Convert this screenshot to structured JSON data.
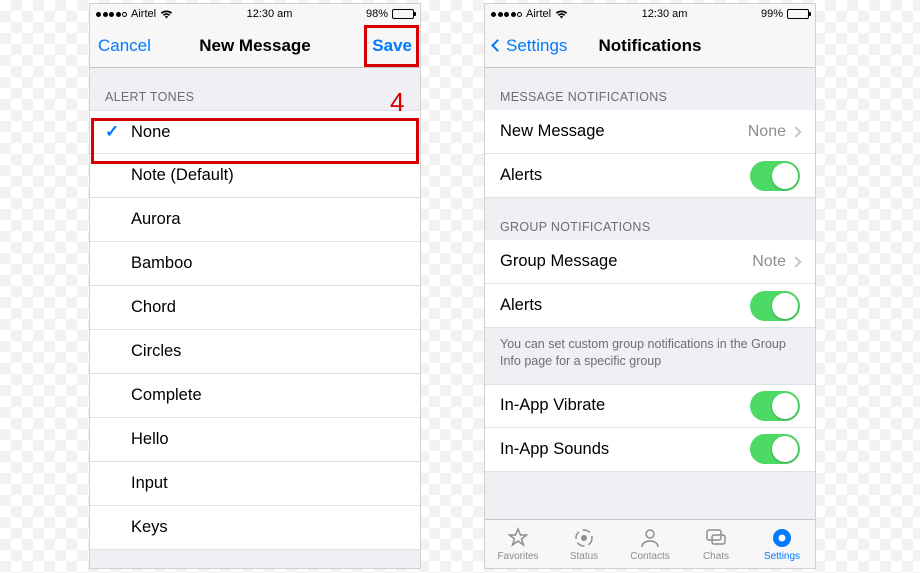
{
  "left": {
    "status": {
      "carrier": "Airtel",
      "time": "12:30 am",
      "battery_pct": "98%"
    },
    "nav": {
      "cancel": "Cancel",
      "title": "New Message",
      "save": "Save"
    },
    "section_header": "ALERT TONES",
    "annotation_number": "4",
    "tones": [
      {
        "label": "None",
        "selected": true
      },
      {
        "label": "Note (Default)",
        "selected": false
      },
      {
        "label": "Aurora",
        "selected": false
      },
      {
        "label": "Bamboo",
        "selected": false
      },
      {
        "label": "Chord",
        "selected": false
      },
      {
        "label": "Circles",
        "selected": false
      },
      {
        "label": "Complete",
        "selected": false
      },
      {
        "label": "Hello",
        "selected": false
      },
      {
        "label": "Input",
        "selected": false
      },
      {
        "label": "Keys",
        "selected": false
      }
    ]
  },
  "right": {
    "status": {
      "carrier": "Airtel",
      "time": "12:30 am",
      "battery_pct": "99%"
    },
    "nav": {
      "back": "Settings",
      "title": "Notifications"
    },
    "sections": {
      "msg_header": "MESSAGE NOTIFICATIONS",
      "new_message_label": "New Message",
      "new_message_value": "None",
      "alerts_label": "Alerts",
      "grp_header": "GROUP NOTIFICATIONS",
      "group_message_label": "Group Message",
      "group_message_value": "Note",
      "group_alerts_label": "Alerts",
      "footer_note": "You can set custom group notifications in the Group Info page for a specific group",
      "inapp_vibrate_label": "In-App Vibrate",
      "inapp_sounds_label": "In-App Sounds"
    },
    "tabs": [
      {
        "label": "Favorites"
      },
      {
        "label": "Status"
      },
      {
        "label": "Contacts"
      },
      {
        "label": "Chats"
      },
      {
        "label": "Settings"
      }
    ]
  }
}
